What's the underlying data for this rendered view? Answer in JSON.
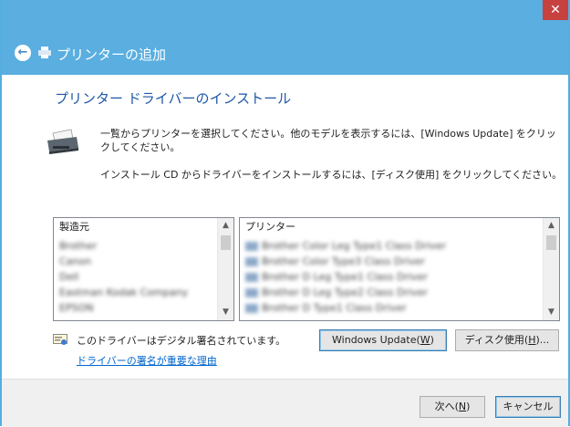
{
  "window": {
    "close_glyph": "✕",
    "nav_title": "プリンターの追加",
    "back_glyph": "←"
  },
  "page": {
    "heading": "プリンター ドライバーのインストール",
    "description1": "一覧からプリンターを選択してください。他のモデルを表示するには、[Windows Update] をクリックしてください。",
    "description2": "インストール CD からドライバーをインストールするには、[ディスク使用] をクリックしてください。"
  },
  "manufacturer_list": {
    "header": "製造元",
    "items": [
      "Brother",
      "Canon",
      "Dell",
      "Eastman Kodak Company",
      "EPSON"
    ]
  },
  "printer_list": {
    "header": "プリンター",
    "items": [
      "Brother Color Leg Type1 Class Driver",
      "Brother Color Type3 Class Driver",
      "Brother D Leg Type1 Class Driver",
      "Brother D Leg Type2 Class Driver",
      "Brother D Type1 Class Driver"
    ]
  },
  "signature": {
    "status_text": "このドライバーはデジタル署名されています。",
    "link_text": "ドライバーの署名が重要な理由"
  },
  "buttons": {
    "windows_update": {
      "label": "Windows Update(",
      "accel": "W",
      "suffix": ")"
    },
    "have_disk": {
      "label": "ディスク使用(",
      "accel": "H",
      "suffix": ")..."
    },
    "next": {
      "label": "次へ(",
      "accel": "N",
      "suffix": ")"
    },
    "cancel": "キャンセル"
  },
  "colors": {
    "title_bar": "#5aaee0",
    "close_button": "#c7413f",
    "heading": "#1d57a8",
    "link": "#0066cc"
  }
}
